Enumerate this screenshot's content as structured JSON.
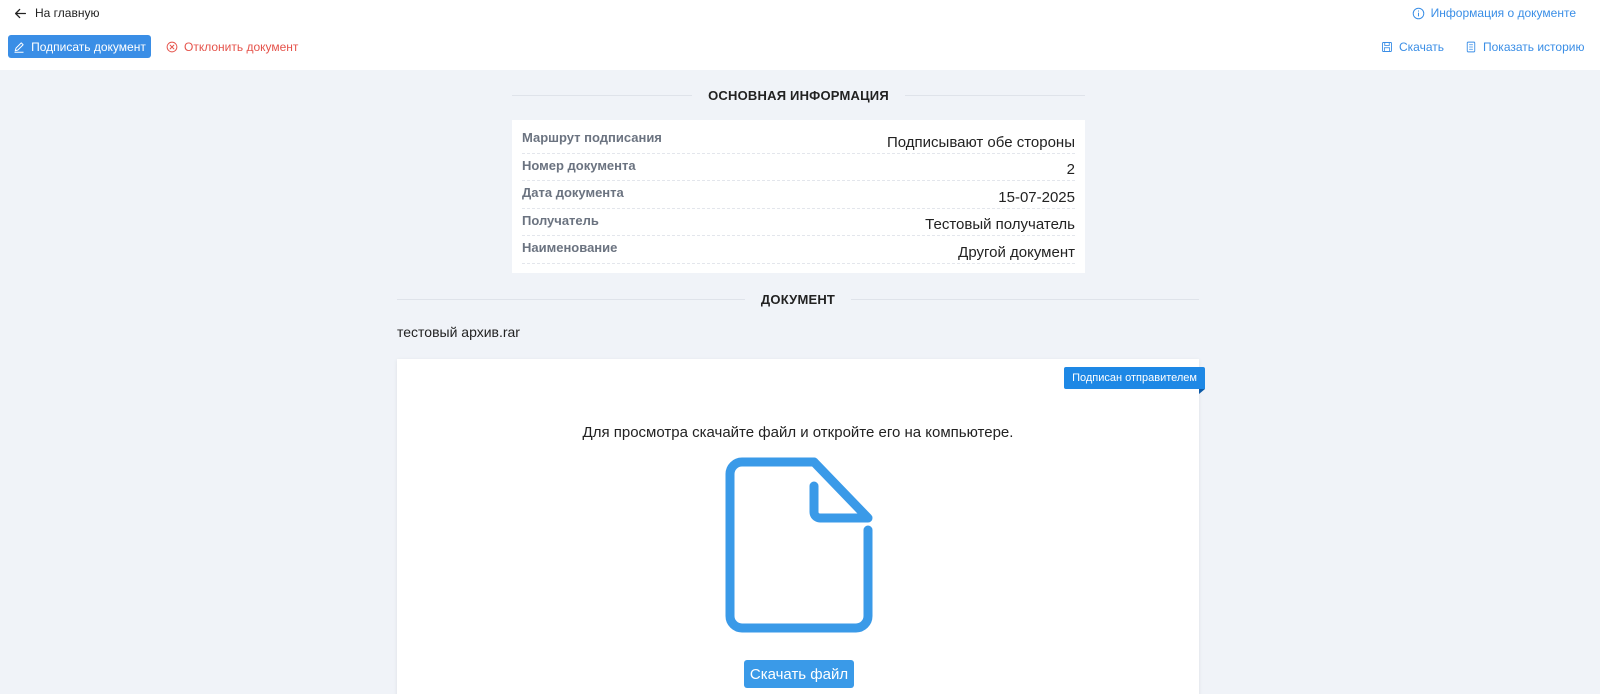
{
  "header": {
    "back_label": "На главную",
    "info_label": "Информация о документе",
    "sign_label": "Подписать документ",
    "reject_label": "Отклонить документ",
    "download_label": "Скачать",
    "history_label": "Показать историю"
  },
  "main_info": {
    "title": "ОСНОВНАЯ ИНФОРМАЦИЯ",
    "rows": [
      {
        "label": "Маршрут подписания",
        "value": "Подписывают обе стороны"
      },
      {
        "label": "Номер документа",
        "value": "2"
      },
      {
        "label": "Дата документа",
        "value": "15-07-2025"
      },
      {
        "label": "Получатель",
        "value": "Тестовый получатель"
      },
      {
        "label": "Наименование",
        "value": "Другой документ"
      }
    ]
  },
  "document": {
    "title": "ДОКУМЕНТ",
    "file_name": "тестовый архив.rar",
    "badge": "Подписан отправителем",
    "hint": "Для просмотра скачайте файл и откройте его на компьютере.",
    "download_file_label": "Скачать файл",
    "icon": "file-icon"
  },
  "colors": {
    "primary": "#3a8ee6",
    "danger": "#e5534b",
    "background": "#f0f3f8",
    "icon_blue": "#3a9ae8"
  }
}
